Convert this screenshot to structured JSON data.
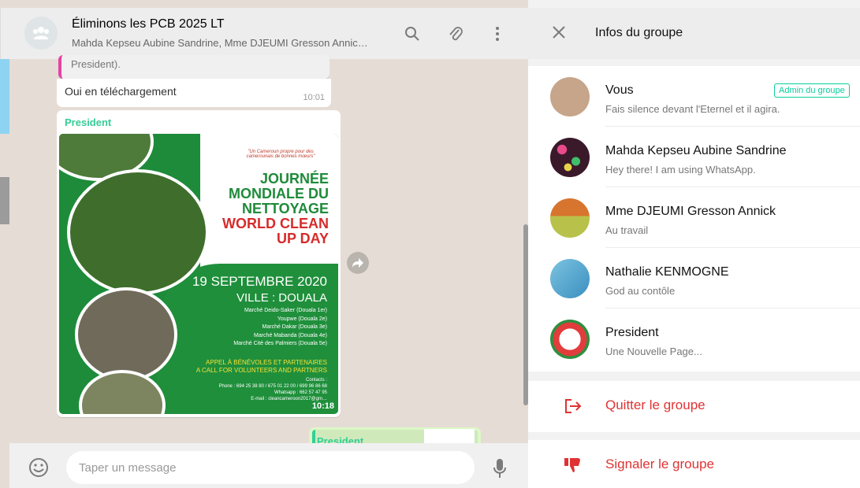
{
  "chat": {
    "title": "Éliminons les PCB 2025 LT",
    "subtitle": "Mahda Kepseu Aubine Sandrine, Mme DJEUMI Gresson Annic…",
    "quoted_text": "President).",
    "reply": {
      "text": "Oui en téléchargement",
      "time": "10:01"
    },
    "image_message": {
      "sender": "President",
      "time": "10:18",
      "poster": {
        "slogan": "\"Un Cameroun propre pour des camerounais de bonnes mœurs\"",
        "title_line1": "JOURNÉE",
        "title_line2": "MONDIALE DU",
        "title_line3": "NETTOYAGE",
        "title_line4": "WORLD CLEAN",
        "title_line5": "UP DAY",
        "date": "19 SEPTEMBRE 2020",
        "city": "VILLE : DOUALA",
        "markets": [
          "Marché Deido-Saker (Douala 1er)",
          "Youpwe (Douala 2e)",
          "Marché Dakar (Douala 3e)",
          "Marché Mabanda (Douala 4e)",
          "Marché Cité des Palmiers (Douala 5e)"
        ],
        "appeal_fr": "APPEL À BÉNÉVOLES ET PARTENAIRES",
        "appeal_en": "A CALL FOR VOLUNTEERS AND PARTNERS",
        "contacts_label": "Contacts :",
        "contacts_phone": "Phone : 694 25 38 80 / 675 01 22 00 / 699 96 86 68",
        "contacts_whatsapp": "Whatsapp : 662 57 47 95",
        "contacts_email": "E-mail : cleancameroon2017@gm…"
      }
    },
    "outgoing_quote_sender": "President",
    "composer_placeholder": "Taper un message"
  },
  "info": {
    "title": "Infos du groupe",
    "members": [
      {
        "name": "Vous",
        "status": "Fais silence devant l'Eternel et il agira.",
        "badge": "Admin du groupe",
        "avatar_color": "#c7a58a"
      },
      {
        "name": "Mahda Kepseu Aubine Sandrine",
        "status": "Hey there! I am using WhatsApp.",
        "avatar_color": "#6b1f3a"
      },
      {
        "name": "Mme DJEUMI Gresson Annick",
        "status": "Au travail",
        "avatar_color": "#b8c24a"
      },
      {
        "name": "Nathalie KENMOGNE",
        "status": "God au contôle",
        "avatar_color": "#5aa3c7"
      },
      {
        "name": "President",
        "status": "Une Nouvelle Page...",
        "avatar_color": "#e23c3c"
      }
    ],
    "actions": {
      "leave": "Quitter le groupe",
      "report": "Signaler le groupe"
    }
  },
  "colors": {
    "accent_green": "#35cd96",
    "danger_red": "#df3333",
    "chat_bg": "#e5ddd5"
  }
}
